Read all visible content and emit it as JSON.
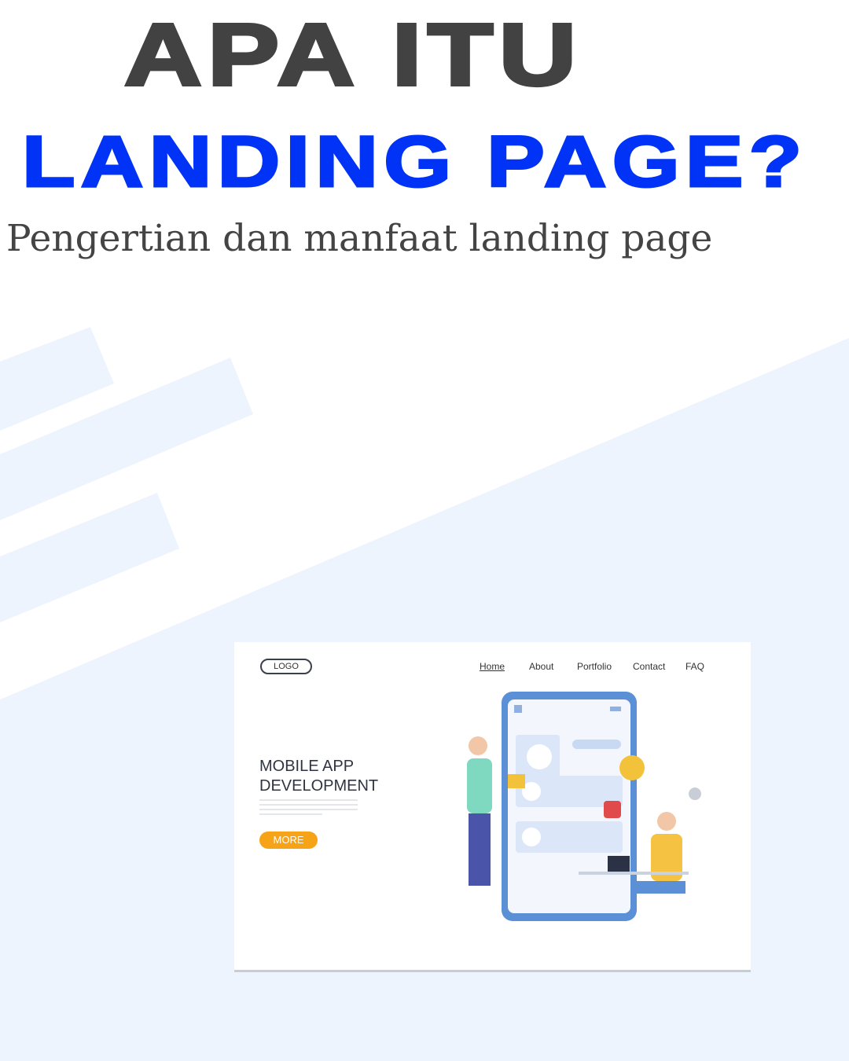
{
  "headline": {
    "line1": "APA ITU",
    "line2": "LANDING PAGE?",
    "subtitle": "Pengertian dan manfaat landing page"
  },
  "colors": {
    "title_dark": "#424242",
    "title_blue": "#0033f5",
    "background_tint": "#eef4fd",
    "button": "#f7a318"
  },
  "mockup": {
    "logo": "LOGO",
    "nav": [
      "Home",
      "About",
      "Portfolio",
      "Contact",
      "FAQ"
    ],
    "heading_line1": "MOBILE APP",
    "heading_line2": "DEVELOPMENT",
    "button": "MORE",
    "icons": [
      "chart-icon",
      "battery-icon",
      "share-icon",
      "heart-icon",
      "code-icon",
      "gear-icon",
      "laptop-icon"
    ]
  }
}
